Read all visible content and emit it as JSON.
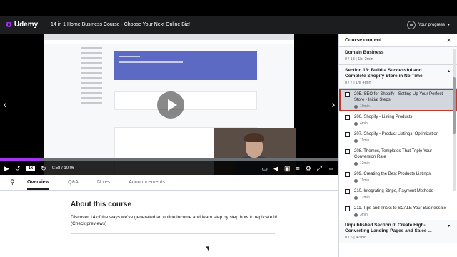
{
  "header": {
    "logo_text": "Udemy",
    "course_title": "14 in 1 Home Business Course - Choose Your Next Online Biz!",
    "progress_label": "Your progress"
  },
  "player": {
    "speed": "1x",
    "time": "0:58 / 10:06",
    "progress_fraction": 0.12
  },
  "tabs": [
    {
      "label": "Overview",
      "active": true
    },
    {
      "label": "Q&A",
      "active": false
    },
    {
      "label": "Notes",
      "active": false
    },
    {
      "label": "Announcements",
      "active": false
    }
  ],
  "about": {
    "title": "About this course",
    "description": "Discover 14 of the ways we've generated an online income and learn step by step how to replicate it! (Check previews)"
  },
  "sidebar": {
    "title": "Course content",
    "prev_section": {
      "title": "Domain Business",
      "meta": "0 / 18 | 1hr 2min"
    },
    "section": {
      "title": "Section 13: Build a Successful and Complete Shopify Store in No Time",
      "meta": "0 / 7 | 1hr 4min"
    },
    "lectures": [
      {
        "title": "205. SEO for Shopify - Setting Up Your Perfect Store - Initial Steps",
        "duration": "10min",
        "current": true
      },
      {
        "title": "206. Shopify - Listing Products",
        "duration": "4min",
        "current": false
      },
      {
        "title": "207. Shopify - Product Listings, Optimization",
        "duration": "11min",
        "current": false
      },
      {
        "title": "208. Themes, Templates That Triple Your Conversion Rate",
        "duration": "12min",
        "current": false
      },
      {
        "title": "209. Creating the Best Products Listings.",
        "duration": "11min",
        "current": false
      },
      {
        "title": "210. Integrating Stripe, Payment Methods",
        "duration": "12min",
        "current": false
      },
      {
        "title": "211. Tips and Tricks to SCALE Your Business 5x",
        "duration": "3min",
        "current": false
      }
    ],
    "next_section": {
      "title": "Unpublished Section 0: Create High-Converting Landing Pages and Sales ...",
      "meta": "0 / 6 | 47min"
    }
  },
  "colors": {
    "accent": "#a435f0",
    "header_bg": "#1c1d1f",
    "highlight_border": "#c0392b"
  }
}
